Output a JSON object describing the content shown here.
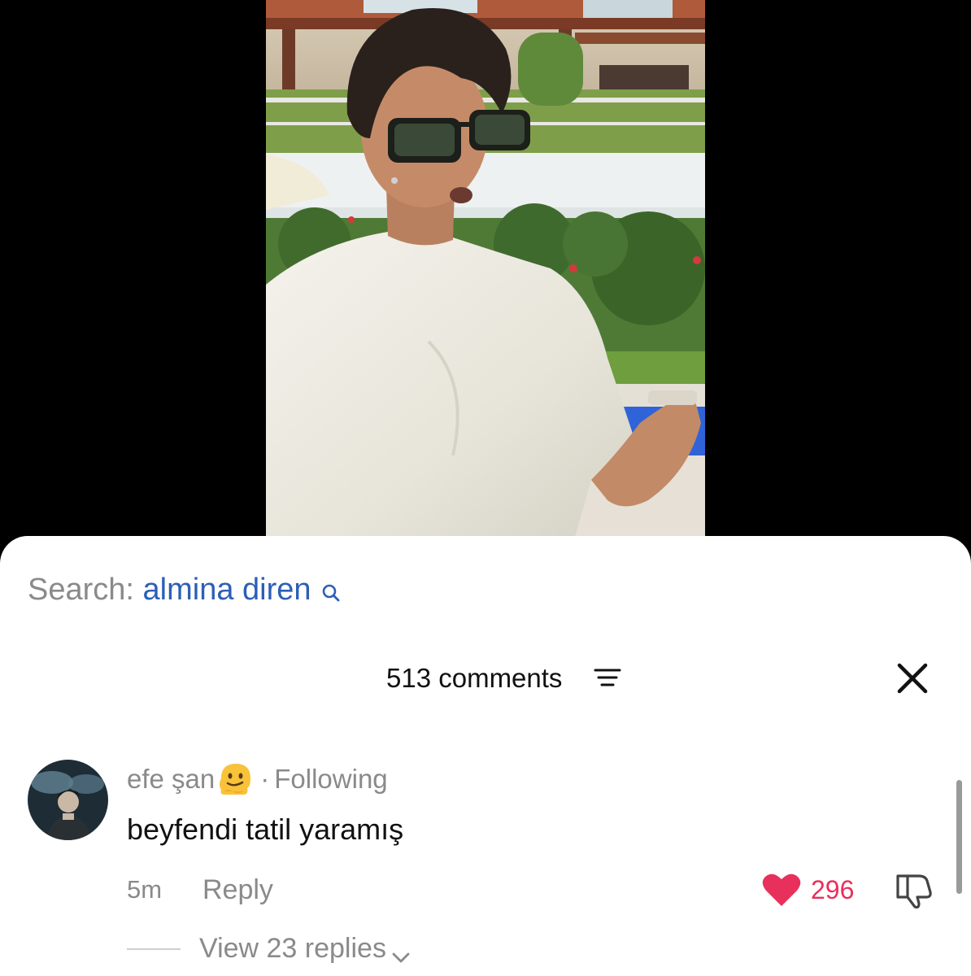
{
  "search": {
    "prefix": "Search:",
    "term": "almina diren"
  },
  "header": {
    "comment_count": "513 comments"
  },
  "comment": {
    "username": "efe şan",
    "relationship": "Following",
    "separator": "·",
    "text": "beyfendi tatil yaramış",
    "time": "5m",
    "reply_label": "Reply",
    "likes": "296",
    "view_replies": "View 23 replies"
  },
  "icons": {
    "search": "search-icon",
    "sort": "sort-lines-icon",
    "close": "close-icon",
    "emoji": "melting-face-emoji-icon",
    "heart": "heart-icon",
    "dislike": "thumbs-down-icon",
    "chevron": "chevron-down-icon"
  },
  "colors": {
    "search_term": "#2d5fb6",
    "like": "#e8305c",
    "muted_text": "#8a8a8a"
  }
}
